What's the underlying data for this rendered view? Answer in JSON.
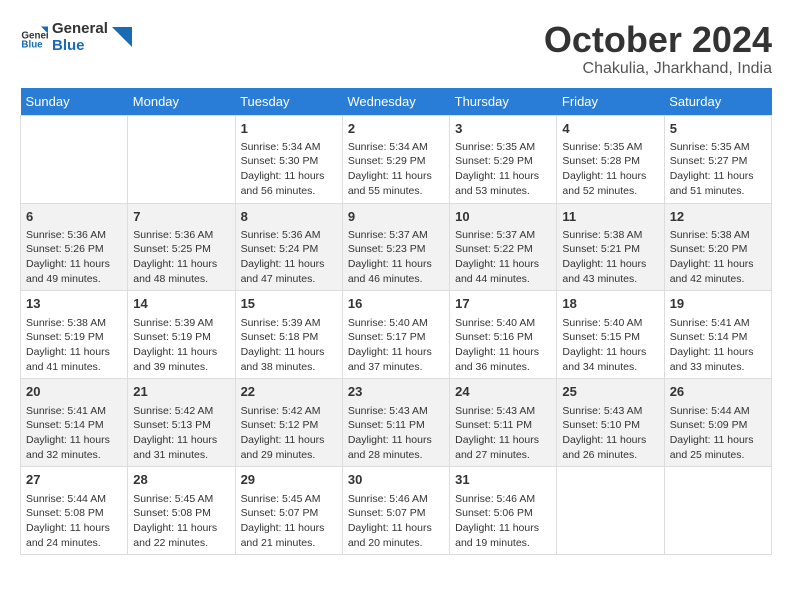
{
  "header": {
    "logo_line1": "General",
    "logo_line2": "Blue",
    "month": "October 2024",
    "location": "Chakulia, Jharkhand, India"
  },
  "weekdays": [
    "Sunday",
    "Monday",
    "Tuesday",
    "Wednesday",
    "Thursday",
    "Friday",
    "Saturday"
  ],
  "weeks": [
    [
      {
        "day": null
      },
      {
        "day": null
      },
      {
        "day": 1,
        "sunrise": "5:34 AM",
        "sunset": "5:30 PM",
        "daylight": "11 hours and 56 minutes."
      },
      {
        "day": 2,
        "sunrise": "5:34 AM",
        "sunset": "5:29 PM",
        "daylight": "11 hours and 55 minutes."
      },
      {
        "day": 3,
        "sunrise": "5:35 AM",
        "sunset": "5:29 PM",
        "daylight": "11 hours and 53 minutes."
      },
      {
        "day": 4,
        "sunrise": "5:35 AM",
        "sunset": "5:28 PM",
        "daylight": "11 hours and 52 minutes."
      },
      {
        "day": 5,
        "sunrise": "5:35 AM",
        "sunset": "5:27 PM",
        "daylight": "11 hours and 51 minutes."
      }
    ],
    [
      {
        "day": 6,
        "sunrise": "5:36 AM",
        "sunset": "5:26 PM",
        "daylight": "11 hours and 49 minutes."
      },
      {
        "day": 7,
        "sunrise": "5:36 AM",
        "sunset": "5:25 PM",
        "daylight": "11 hours and 48 minutes."
      },
      {
        "day": 8,
        "sunrise": "5:36 AM",
        "sunset": "5:24 PM",
        "daylight": "11 hours and 47 minutes."
      },
      {
        "day": 9,
        "sunrise": "5:37 AM",
        "sunset": "5:23 PM",
        "daylight": "11 hours and 46 minutes."
      },
      {
        "day": 10,
        "sunrise": "5:37 AM",
        "sunset": "5:22 PM",
        "daylight": "11 hours and 44 minutes."
      },
      {
        "day": 11,
        "sunrise": "5:38 AM",
        "sunset": "5:21 PM",
        "daylight": "11 hours and 43 minutes."
      },
      {
        "day": 12,
        "sunrise": "5:38 AM",
        "sunset": "5:20 PM",
        "daylight": "11 hours and 42 minutes."
      }
    ],
    [
      {
        "day": 13,
        "sunrise": "5:38 AM",
        "sunset": "5:19 PM",
        "daylight": "11 hours and 41 minutes."
      },
      {
        "day": 14,
        "sunrise": "5:39 AM",
        "sunset": "5:19 PM",
        "daylight": "11 hours and 39 minutes."
      },
      {
        "day": 15,
        "sunrise": "5:39 AM",
        "sunset": "5:18 PM",
        "daylight": "11 hours and 38 minutes."
      },
      {
        "day": 16,
        "sunrise": "5:40 AM",
        "sunset": "5:17 PM",
        "daylight": "11 hours and 37 minutes."
      },
      {
        "day": 17,
        "sunrise": "5:40 AM",
        "sunset": "5:16 PM",
        "daylight": "11 hours and 36 minutes."
      },
      {
        "day": 18,
        "sunrise": "5:40 AM",
        "sunset": "5:15 PM",
        "daylight": "11 hours and 34 minutes."
      },
      {
        "day": 19,
        "sunrise": "5:41 AM",
        "sunset": "5:14 PM",
        "daylight": "11 hours and 33 minutes."
      }
    ],
    [
      {
        "day": 20,
        "sunrise": "5:41 AM",
        "sunset": "5:14 PM",
        "daylight": "11 hours and 32 minutes."
      },
      {
        "day": 21,
        "sunrise": "5:42 AM",
        "sunset": "5:13 PM",
        "daylight": "11 hours and 31 minutes."
      },
      {
        "day": 22,
        "sunrise": "5:42 AM",
        "sunset": "5:12 PM",
        "daylight": "11 hours and 29 minutes."
      },
      {
        "day": 23,
        "sunrise": "5:43 AM",
        "sunset": "5:11 PM",
        "daylight": "11 hours and 28 minutes."
      },
      {
        "day": 24,
        "sunrise": "5:43 AM",
        "sunset": "5:11 PM",
        "daylight": "11 hours and 27 minutes."
      },
      {
        "day": 25,
        "sunrise": "5:43 AM",
        "sunset": "5:10 PM",
        "daylight": "11 hours and 26 minutes."
      },
      {
        "day": 26,
        "sunrise": "5:44 AM",
        "sunset": "5:09 PM",
        "daylight": "11 hours and 25 minutes."
      }
    ],
    [
      {
        "day": 27,
        "sunrise": "5:44 AM",
        "sunset": "5:08 PM",
        "daylight": "11 hours and 24 minutes."
      },
      {
        "day": 28,
        "sunrise": "5:45 AM",
        "sunset": "5:08 PM",
        "daylight": "11 hours and 22 minutes."
      },
      {
        "day": 29,
        "sunrise": "5:45 AM",
        "sunset": "5:07 PM",
        "daylight": "11 hours and 21 minutes."
      },
      {
        "day": 30,
        "sunrise": "5:46 AM",
        "sunset": "5:07 PM",
        "daylight": "11 hours and 20 minutes."
      },
      {
        "day": 31,
        "sunrise": "5:46 AM",
        "sunset": "5:06 PM",
        "daylight": "11 hours and 19 minutes."
      },
      {
        "day": null
      },
      {
        "day": null
      }
    ]
  ]
}
